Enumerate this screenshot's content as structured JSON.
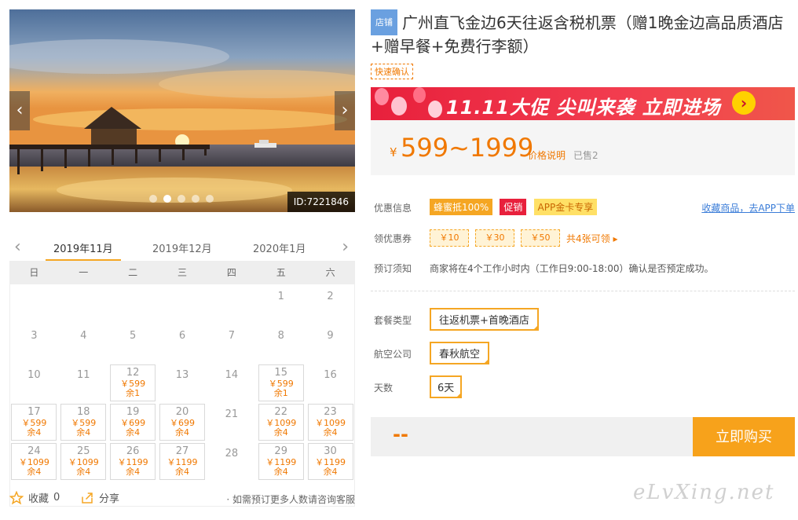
{
  "gallery": {
    "prev_icon": "‹",
    "next_icon": "›",
    "image_id": "ID:7221846",
    "dots": [
      false,
      true,
      false,
      false,
      false
    ]
  },
  "calendar": {
    "prev_icon": "‹",
    "next_icon": "›",
    "months": [
      "2019年11月",
      "2019年12月",
      "2020年1月"
    ],
    "weekdays": [
      "日",
      "一",
      "二",
      "三",
      "四",
      "五",
      "六"
    ],
    "days": [
      {
        "d": "1"
      },
      {
        "d": "2"
      },
      {
        "d": "3"
      },
      {
        "d": "4"
      },
      {
        "d": "5"
      },
      {
        "d": "6"
      },
      {
        "d": "7"
      },
      {
        "d": "8"
      },
      {
        "d": "9"
      },
      {
        "d": "10"
      },
      {
        "d": "11"
      },
      {
        "d": "12",
        "p": "￥599",
        "r": "余1"
      },
      {
        "d": "13"
      },
      {
        "d": "14"
      },
      {
        "d": "15",
        "p": "￥599",
        "r": "余1"
      },
      {
        "d": "16"
      },
      {
        "d": "17",
        "p": "￥599",
        "r": "余4"
      },
      {
        "d": "18",
        "p": "￥599",
        "r": "余4"
      },
      {
        "d": "19",
        "p": "￥699",
        "r": "余4"
      },
      {
        "d": "20",
        "p": "￥699",
        "r": "余4"
      },
      {
        "d": "21"
      },
      {
        "d": "22",
        "p": "￥1099",
        "r": "余4"
      },
      {
        "d": "23",
        "p": "￥1099",
        "r": "余4"
      },
      {
        "d": "24",
        "p": "￥1099",
        "r": "余4"
      },
      {
        "d": "25",
        "p": "￥1099",
        "r": "余4"
      },
      {
        "d": "26",
        "p": "￥1199",
        "r": "余4"
      },
      {
        "d": "27",
        "p": "￥1199",
        "r": "余4"
      },
      {
        "d": "28"
      },
      {
        "d": "29",
        "p": "￥1199",
        "r": "余4"
      },
      {
        "d": "30",
        "p": "￥1199",
        "r": "余4"
      }
    ]
  },
  "bottom": {
    "favorite_label": "收藏",
    "favorite_count": "0",
    "share_label": "分享",
    "note": "· 如需预订更多人数请咨询客服"
  },
  "product": {
    "shop_tag": "店铺",
    "title": "广州直飞金边6天往返含税机票（赠1晚金边高品质酒店+赠早餐+免费行李额）",
    "fast_tag": "快速确认",
    "banner_text": "11.11大促 尖叫来袭  立即进场",
    "banner_go": "›",
    "price_yen": "¥",
    "price_amount": "599~1999",
    "price_explain": "价格说明",
    "sold": "已售2"
  },
  "info": {
    "promo_label": "优惠信息",
    "promo_tags": [
      "蜂蜜抵100%",
      "促销",
      "APP金卡专享"
    ],
    "fav_app": "收藏商品，去APP下单",
    "coupon_label": "领优惠券",
    "coupons": [
      "￥10",
      "￥30",
      "￥50"
    ],
    "coupon_more": "共4张可领 ▸",
    "notice_label": "预订须知",
    "notice_text": "商家将在4个工作小时内（工作日9:00-18:00）确认是否预定成功。",
    "package_label": "套餐类型",
    "package_value": "往返机票+首晚酒店",
    "airline_label": "航空公司",
    "airline_value": "春秋航空",
    "days_label": "天数",
    "days_value": "6天"
  },
  "buy": {
    "total": "--",
    "button": "立即购买"
  },
  "watermark": "eLvXing.net",
  "colors": {
    "accent": "#f7a21b",
    "price": "#f07800",
    "promo_red": "#e8203c",
    "link": "#3b7dd8"
  }
}
